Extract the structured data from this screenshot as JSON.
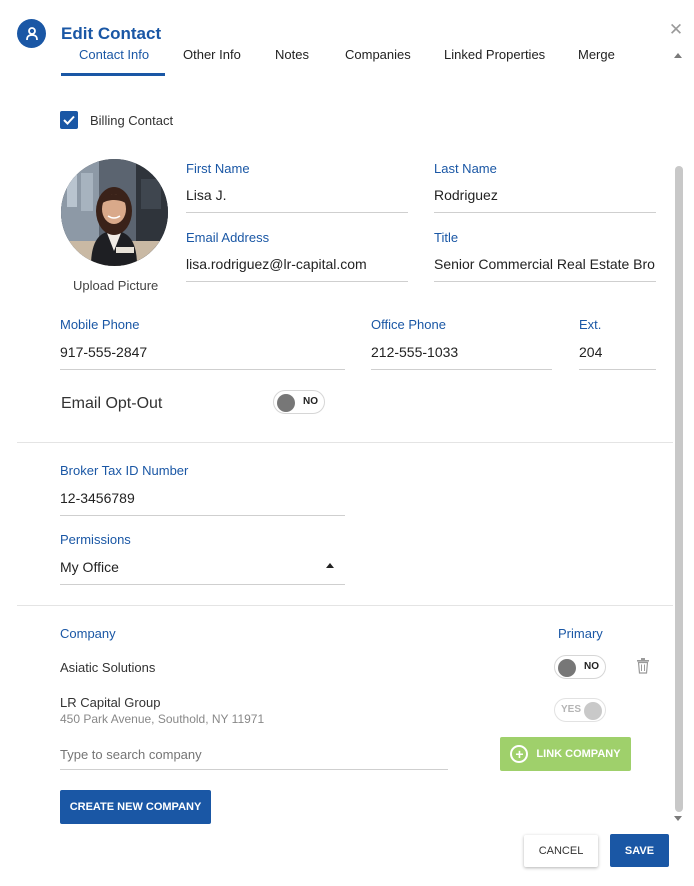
{
  "header": {
    "title": "Edit Contact",
    "icon": "contact-badge-icon"
  },
  "tabs": [
    {
      "label": "Contact Info",
      "active": true
    },
    {
      "label": "Other Info"
    },
    {
      "label": "Notes"
    },
    {
      "label": "Companies"
    },
    {
      "label": "Linked Properties"
    },
    {
      "label": "Merge"
    }
  ],
  "billing": {
    "label": "Billing Contact",
    "checked": true
  },
  "avatar": {
    "upload_label": "Upload Picture"
  },
  "fields": {
    "first_name": {
      "label": "First Name",
      "value": "Lisa J."
    },
    "last_name": {
      "label": "Last Name",
      "value": "Rodriguez"
    },
    "email": {
      "label": "Email Address",
      "value": "lisa.rodriguez@lr-capital.com"
    },
    "title": {
      "label": "Title",
      "value": "Senior Commercial Real Estate Bro"
    },
    "mobile": {
      "label": "Mobile Phone",
      "value": "917-555-2847"
    },
    "office": {
      "label": "Office Phone",
      "value": "212-555-1033"
    },
    "ext": {
      "label": "Ext.",
      "value": "204"
    }
  },
  "opt_out": {
    "label": "Email Opt-Out",
    "toggle": "NO"
  },
  "broker": {
    "label": "Broker Tax ID Number",
    "value": "12-3456789"
  },
  "permissions": {
    "label": "Permissions",
    "value": "My Office"
  },
  "companies": {
    "header_company": "Company",
    "header_primary": "Primary",
    "rows": [
      {
        "name": "Asiatic Solutions",
        "address": "",
        "primary": "NO"
      },
      {
        "name": "LR Capital Group",
        "address": "450 Park Avenue, Southold, NY 11971",
        "primary": "YES"
      }
    ],
    "search_placeholder": "Type to search company",
    "link_label": "LINK COMPANY",
    "create_label": "CREATE NEW COMPANY"
  },
  "footer": {
    "cancel_label": "CANCEL",
    "save_label": "SAVE"
  },
  "colors": {
    "primary": "#1a57a5",
    "link_green": "#9fd06b"
  }
}
